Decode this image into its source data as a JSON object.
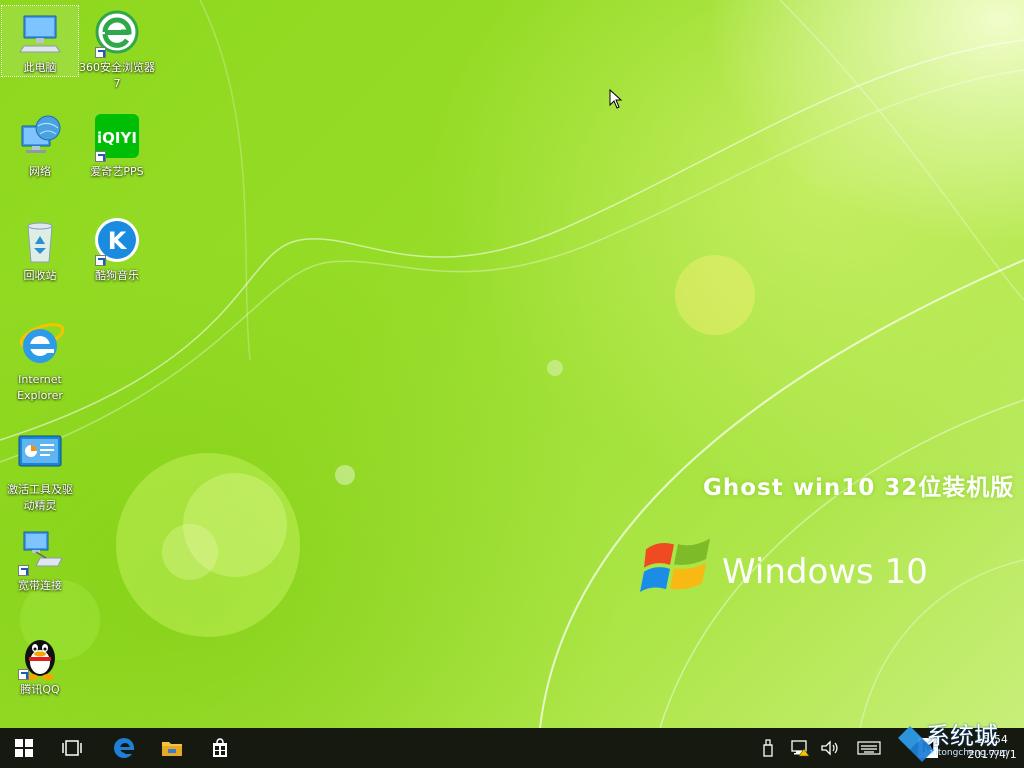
{
  "desktop": {
    "icons": [
      {
        "label": "此电脑",
        "icon": "computer-icon"
      },
      {
        "label": "360安全浏览器7",
        "icon": "browser-360-icon"
      },
      {
        "label": "网络",
        "icon": "network-icon"
      },
      {
        "label": "爱奇艺PPS",
        "icon": "iqiyi-icon"
      },
      {
        "label": "回收站",
        "icon": "recycle-bin-icon"
      },
      {
        "label": "酷狗音乐",
        "icon": "kugou-icon"
      },
      {
        "label": "Internet Explorer",
        "icon": "ie-icon"
      },
      {
        "label": "激活工具及驱动精灵",
        "icon": "activation-tool-icon"
      },
      {
        "label": "宽带连接",
        "icon": "broadband-icon"
      },
      {
        "label": "腾讯QQ",
        "icon": "qq-icon"
      }
    ],
    "wallpaper": {
      "brand_line": "Ghost  win10 32位装机版",
      "product_text": "Windows 10"
    }
  },
  "taskbar": {
    "items": [
      {
        "icon": "start-icon"
      },
      {
        "icon": "task-view-icon"
      },
      {
        "icon": "edge-icon"
      },
      {
        "icon": "file-explorer-icon"
      },
      {
        "icon": "store-icon"
      }
    ],
    "tray": {
      "ime": "M",
      "time": "15:54",
      "date": "2017/4/1"
    }
  },
  "watermark": {
    "text": "系统城",
    "sub": "xitongcheng.com"
  },
  "colors": {
    "wallpaper": "#96dc28",
    "taskbar": "#16190f",
    "edge_blue": "#1e7fd6"
  }
}
